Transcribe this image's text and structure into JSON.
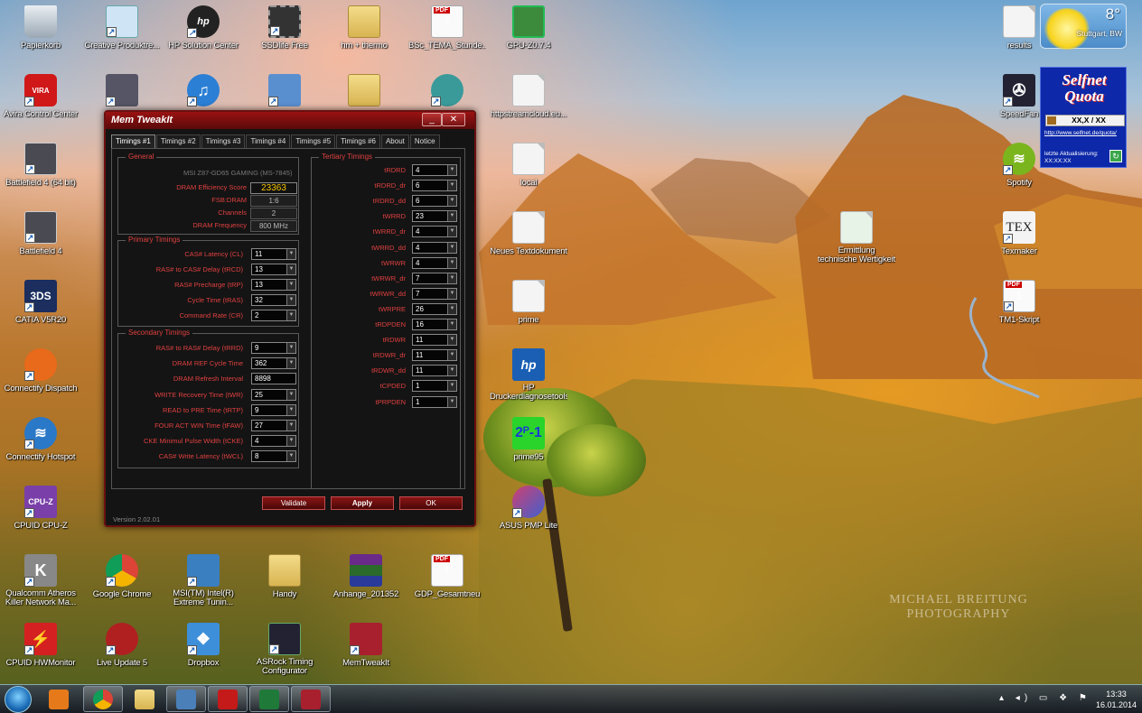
{
  "desktop": {
    "icons": [
      {
        "label": "Papierkorb"
      },
      {
        "label": "Creative Produktre..."
      },
      {
        "label": "HP Solution Center"
      },
      {
        "label": "SSDlife Free"
      },
      {
        "label": "hm + thermo"
      },
      {
        "label": "BSc_TEMA_Stunde..."
      },
      {
        "label": "GPU-Z0.7.4"
      },
      {
        "label": "results"
      },
      {
        "label": "Avira Control Center"
      },
      {
        "label": "httpstreamcloud.eu..."
      },
      {
        "label": "SpeedFan"
      },
      {
        "label": "Battlefield 4 (64 bit)"
      },
      {
        "label": "local"
      },
      {
        "label": "Spotify"
      },
      {
        "label": "Battlefield 4"
      },
      {
        "label": "Neues Textdokument"
      },
      {
        "label": "Ermittlung technische Wertigkeit"
      },
      {
        "label": "Texmaker"
      },
      {
        "label": "CATIA V5R20"
      },
      {
        "label": "prime"
      },
      {
        "label": "TM1-Skript"
      },
      {
        "label": "Connectify Dispatch"
      },
      {
        "label": "HP Druckerdiagnosetools"
      },
      {
        "label": "Connectify Hotspot"
      },
      {
        "label": "prime95"
      },
      {
        "label": "CPUID CPU-Z"
      },
      {
        "label": "ASUS PMP Lite"
      },
      {
        "label": "Qualcomm Atheros Killer Network Ma..."
      },
      {
        "label": "Google Chrome"
      },
      {
        "label": "MSI(TM) Intel(R) Extreme Tunin..."
      },
      {
        "label": "Handy"
      },
      {
        "label": "Anhange_201352"
      },
      {
        "label": "GDP_Gesamtneu"
      },
      {
        "label": "CPUID HWMonitor"
      },
      {
        "label": "Live Update 5"
      },
      {
        "label": "Dropbox"
      },
      {
        "label": "ASRock Timing Configurator"
      },
      {
        "label": "MemTweakIt"
      }
    ],
    "watermark": [
      "MICHAEL BREITUNG",
      "PHOTOGRAPHY"
    ]
  },
  "window": {
    "title": "Mem TweakIt",
    "tabs": [
      "Timings #1",
      "Timings #2",
      "Timings #3",
      "Timings #4",
      "Timings #5",
      "Timings #6",
      "About",
      "Notice"
    ],
    "active_tab": "Timings #1",
    "general": {
      "title": "General",
      "motherboard": "MSI Z87-GD65 GAMING (MS-7845)",
      "rows": [
        {
          "label": "DRAM Efficiency Score",
          "value": "23363"
        },
        {
          "label": "FSB:DRAM",
          "value": "1:6"
        },
        {
          "label": "Channels",
          "value": "2"
        },
        {
          "label": "DRAM Frequency",
          "value": "800 MHz"
        }
      ]
    },
    "primary": {
      "title": "Primary Timings",
      "rows": [
        {
          "label": "CAS# Latency (CL)",
          "value": "11"
        },
        {
          "label": "RAS# to CAS# Delay (tRCD)",
          "value": "13"
        },
        {
          "label": "RAS# Precharge (tRP)",
          "value": "13"
        },
        {
          "label": "Cycle Time (tRAS)",
          "value": "32"
        },
        {
          "label": "Command Rate (CR)",
          "value": "2"
        }
      ]
    },
    "secondary": {
      "title": "Secondary Timings",
      "rows": [
        {
          "label": "RAS# to RAS# Delay (tRRD)",
          "value": "9"
        },
        {
          "label": "DRAM REF Cycle Time",
          "value": "362"
        },
        {
          "label": "DRAM Refresh Interval",
          "value": "8898"
        },
        {
          "label": "WRITE Recovery Time (tWR)",
          "value": "25"
        },
        {
          "label": "READ to PRE Time (tRTP)",
          "value": "9"
        },
        {
          "label": "FOUR ACT WIN Time (tFAW)",
          "value": "27"
        },
        {
          "label": "CKE Minimul Pulse Width (tCKE)",
          "value": "4"
        },
        {
          "label": "CAS# Write Latency (tWCL)",
          "value": "8"
        }
      ]
    },
    "tertiary": {
      "title": "Tertiary Timings",
      "rows": [
        {
          "label": "tRDRD",
          "value": "4"
        },
        {
          "label": "tRDRD_dr",
          "value": "6"
        },
        {
          "label": "tRDRD_dd",
          "value": "6"
        },
        {
          "label": "tWRRD",
          "value": "23"
        },
        {
          "label": "tWRRD_dr",
          "value": "4"
        },
        {
          "label": "tWRRD_dd",
          "value": "4"
        },
        {
          "label": "tWRWR",
          "value": "4"
        },
        {
          "label": "tWRWR_dr",
          "value": "7"
        },
        {
          "label": "tWRWR_dd",
          "value": "7"
        },
        {
          "label": "tWRPRE",
          "value": "26"
        },
        {
          "label": "tRDPDEN",
          "value": "16"
        },
        {
          "label": "tRDWR",
          "value": "11"
        },
        {
          "label": "tRDWR_dr",
          "value": "11"
        },
        {
          "label": "tRDWR_dd",
          "value": "11"
        },
        {
          "label": "tCPDED",
          "value": "1"
        },
        {
          "label": "tPRPDEN",
          "value": "1"
        }
      ]
    },
    "buttons": {
      "validate": "Validate",
      "apply": "Apply",
      "ok": "OK"
    },
    "version": "Version 2.02.01",
    "controls": {
      "minimize": "_",
      "close": "✕"
    }
  },
  "weather": {
    "temp": "8°",
    "city": "Stuttgart, BW"
  },
  "selfnet": {
    "logo_line1": "Selfnet",
    "logo_line2": "Quota",
    "quota": "XX,X / XX",
    "link": "http://www.selfnet.de/quota/",
    "update_label": "letzte Aktualisierung:",
    "update_value": "XX:XX:XX"
  },
  "taskbar": {
    "items": [
      "Windows Media Player",
      "Google Chrome",
      "Windows Explorer",
      "Window",
      "Adobe Reader",
      "Excel",
      "MemTweakIt"
    ],
    "clock_time": "13:33",
    "clock_date": "16.01.2014"
  }
}
